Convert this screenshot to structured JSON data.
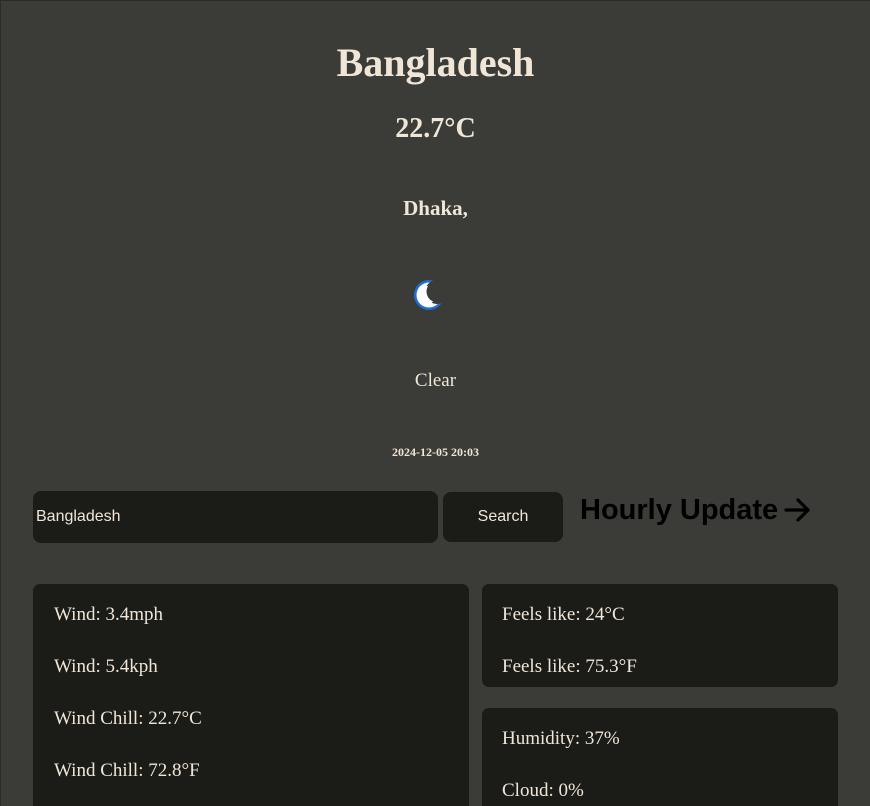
{
  "header": {
    "country": "Bangladesh",
    "temperature": "22.7°C",
    "city": "Dhaka,",
    "condition": "Clear",
    "datetime": "2024-12-05 20:03",
    "condition_icon": "crescent-moon-icon"
  },
  "search": {
    "value": "Bangladesh",
    "button_label": "Search"
  },
  "hourly_link": {
    "label": "Hourly Update",
    "icon": "arrow-right-icon"
  },
  "details": {
    "wind": [
      "Wind: 3.4mph",
      "Wind: 5.4kph",
      "Wind Chill: 22.7°C",
      "Wind Chill: 72.8°F"
    ],
    "feels_like": [
      "Feels like: 24°C",
      "Feels like: 75.3°F"
    ],
    "atmosphere": [
      "Humidity: 37%",
      "Cloud: 0%"
    ]
  },
  "colors": {
    "background": "#3b3b37",
    "card": "#1b1c18",
    "text": "#f0e6d8",
    "moon": "#1d6fd1"
  }
}
